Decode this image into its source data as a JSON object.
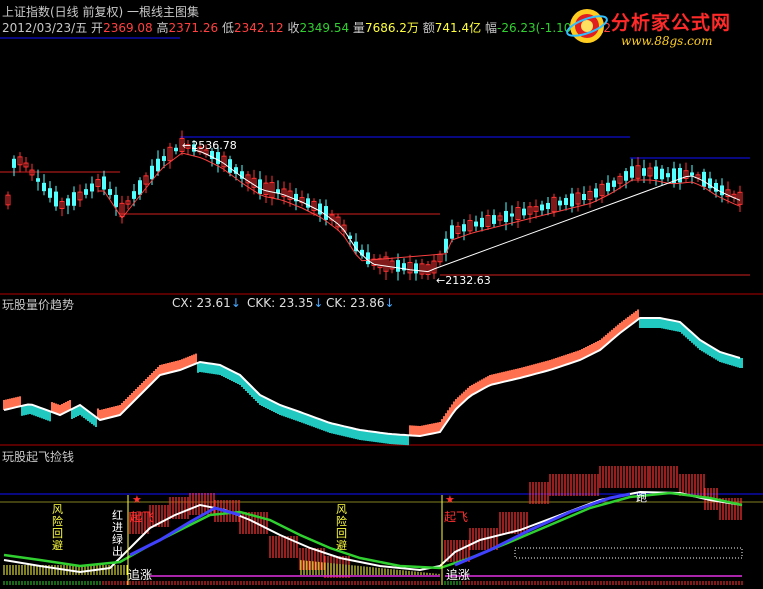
{
  "header": {
    "line1": "上证指数(日线 前复权) 一根线主图集",
    "date": "2012/03/23/五",
    "open_label": "开",
    "open": "2369.08",
    "high_label": "高",
    "high": "2371.26",
    "low_label": "低",
    "low": "2342.12",
    "close_label": "收",
    "close": "2349.54",
    "vol_label": "量",
    "vol": "7686.2万",
    "amt_label": "额",
    "amt": "741.4亿",
    "chg_label": "幅",
    "chg": "-26.23(-1.10%)",
    "amp_label": "振",
    "amp": "2"
  },
  "brand": {
    "title": "分析家公式网",
    "url": "www.88gs.com"
  },
  "panel2": {
    "title": "玩股量价趋势",
    "cx_label": "CX: 23.61",
    "ckk_label": "CKK: 23.35",
    "ck_label": "CK: 23.86",
    "arrow": "↓"
  },
  "panel3": {
    "title": "玩股起飞捡钱",
    "labels": {
      "qifei1": "起飞",
      "qifei2": "起飞",
      "zhuizhang1": "追涨",
      "zhuizhang2": "追涨",
      "hongjin": "红进绿出",
      "vert1": "风险回避",
      "vert2": "风险回避",
      "bao": "跑"
    }
  },
  "colors": {
    "up": "#ff3232",
    "down": "#54ffff",
    "ma": "#ff4040",
    "blue_line": "#1010ff",
    "red_line": "#d02020",
    "white": "#ffffff",
    "green": "#30d030",
    "yellow": "#ffff40",
    "salmon": "#ff7050",
    "teal": "#20c8c0",
    "magenta": "#e030e0"
  },
  "chart_data": [
    {
      "type": "candlestick",
      "series_name": "上证指数",
      "annotations": [
        {
          "text": "2536.78",
          "kind": "high"
        },
        {
          "text": "2132.63",
          "kind": "low"
        }
      ]
    },
    {
      "type": "line",
      "title": "玩股量价趋势",
      "series": [
        {
          "name": "CX",
          "last": 23.61
        },
        {
          "name": "CKK",
          "last": 23.35
        },
        {
          "name": "CK",
          "last": 23.86
        }
      ]
    },
    {
      "type": "bar",
      "title": "玩股起飞捡钱"
    }
  ]
}
